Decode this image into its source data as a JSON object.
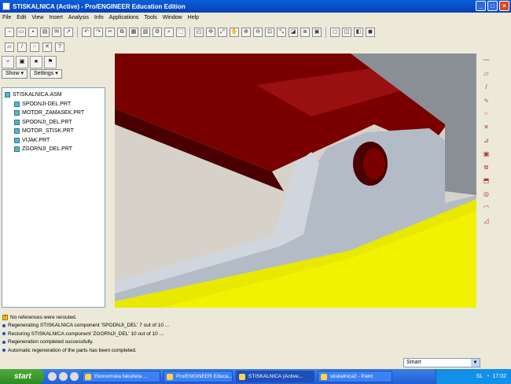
{
  "window": {
    "title": "STISKALNICA (Active) - Pro/ENGINEER Education Edition"
  },
  "menu": [
    "File",
    "Edit",
    "View",
    "Insert",
    "Analysis",
    "Info",
    "Applications",
    "Tools",
    "Window",
    "Help"
  ],
  "panel": {
    "show_label": "Show ▾",
    "settings_label": "Settings ▾"
  },
  "tree": {
    "root": "STISKALNICA.ASM",
    "items": [
      "SPODNJI-DEL.PRT",
      "MOTOR_ZAMASEK.PRT",
      "SPODNJI_DEL.PRT",
      "MOTOR_STISK.PRT",
      "VIJAK.PRT",
      "ZGORNJI_DEL.PRT"
    ]
  },
  "messages": [
    "No references were rerouted.",
    "Regenerating STISKALNICA component 'SPODNJI_DEL' 7 out of 10 ...",
    "Restoring STISKALNICA component 'ZGORNJI_DEL' 10 out of 10 ...",
    "Regeneration completed successfully.",
    "Automatic regeneration of the parts has been completed."
  ],
  "filter": {
    "value": "Smart"
  },
  "taskbar": {
    "start": "start",
    "tasks": [
      "Ekonomska fakulteta ...",
      "Pro/ENGINEER Educa...",
      "STISKALNICA (Active...",
      "stiskalnica2 - Paint"
    ],
    "lang": "SL",
    "clock": "17:02"
  },
  "colors": {
    "part_red": "#7a0000",
    "part_grey": "#b3bcc6",
    "part_yellow": "#e8e800"
  }
}
